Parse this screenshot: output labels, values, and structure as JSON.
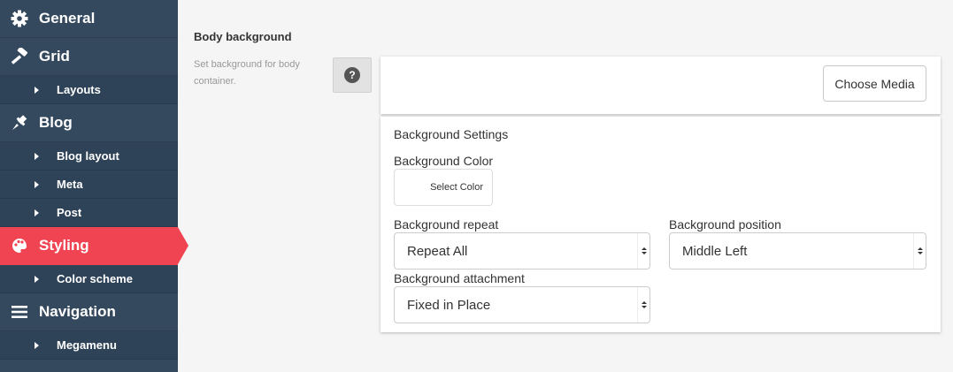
{
  "sidebar": {
    "items": [
      {
        "label": "General",
        "icon": "gear-icon"
      },
      {
        "label": "Grid",
        "icon": "hammer-icon"
      },
      {
        "label": "Layouts",
        "sub": true
      },
      {
        "label": "Blog",
        "icon": "pushpin-icon"
      },
      {
        "label": "Blog layout",
        "sub": true
      },
      {
        "label": "Meta",
        "sub": true
      },
      {
        "label": "Post",
        "sub": true
      },
      {
        "label": "Styling",
        "icon": "palette-icon",
        "active": true
      },
      {
        "label": "Color scheme",
        "sub": true
      },
      {
        "label": "Navigation",
        "icon": "menu-icon"
      },
      {
        "label": "Megamenu",
        "sub": true
      }
    ]
  },
  "main": {
    "title": "Body background",
    "description": "Set background for body container.",
    "help_label": "?",
    "choose_media": "Choose Media",
    "settings": {
      "title": "Background Settings",
      "color_label": "Background Color",
      "color_button": "Select Color",
      "repeat_label": "Background repeat",
      "repeat_value": "Repeat All",
      "position_label": "Background position",
      "position_value": "Middle Left",
      "attachment_label": "Background attachment",
      "attachment_value": "Fixed in Place"
    }
  },
  "colors": {
    "sidebar_bg": "#34495e",
    "active": "#f04452"
  }
}
